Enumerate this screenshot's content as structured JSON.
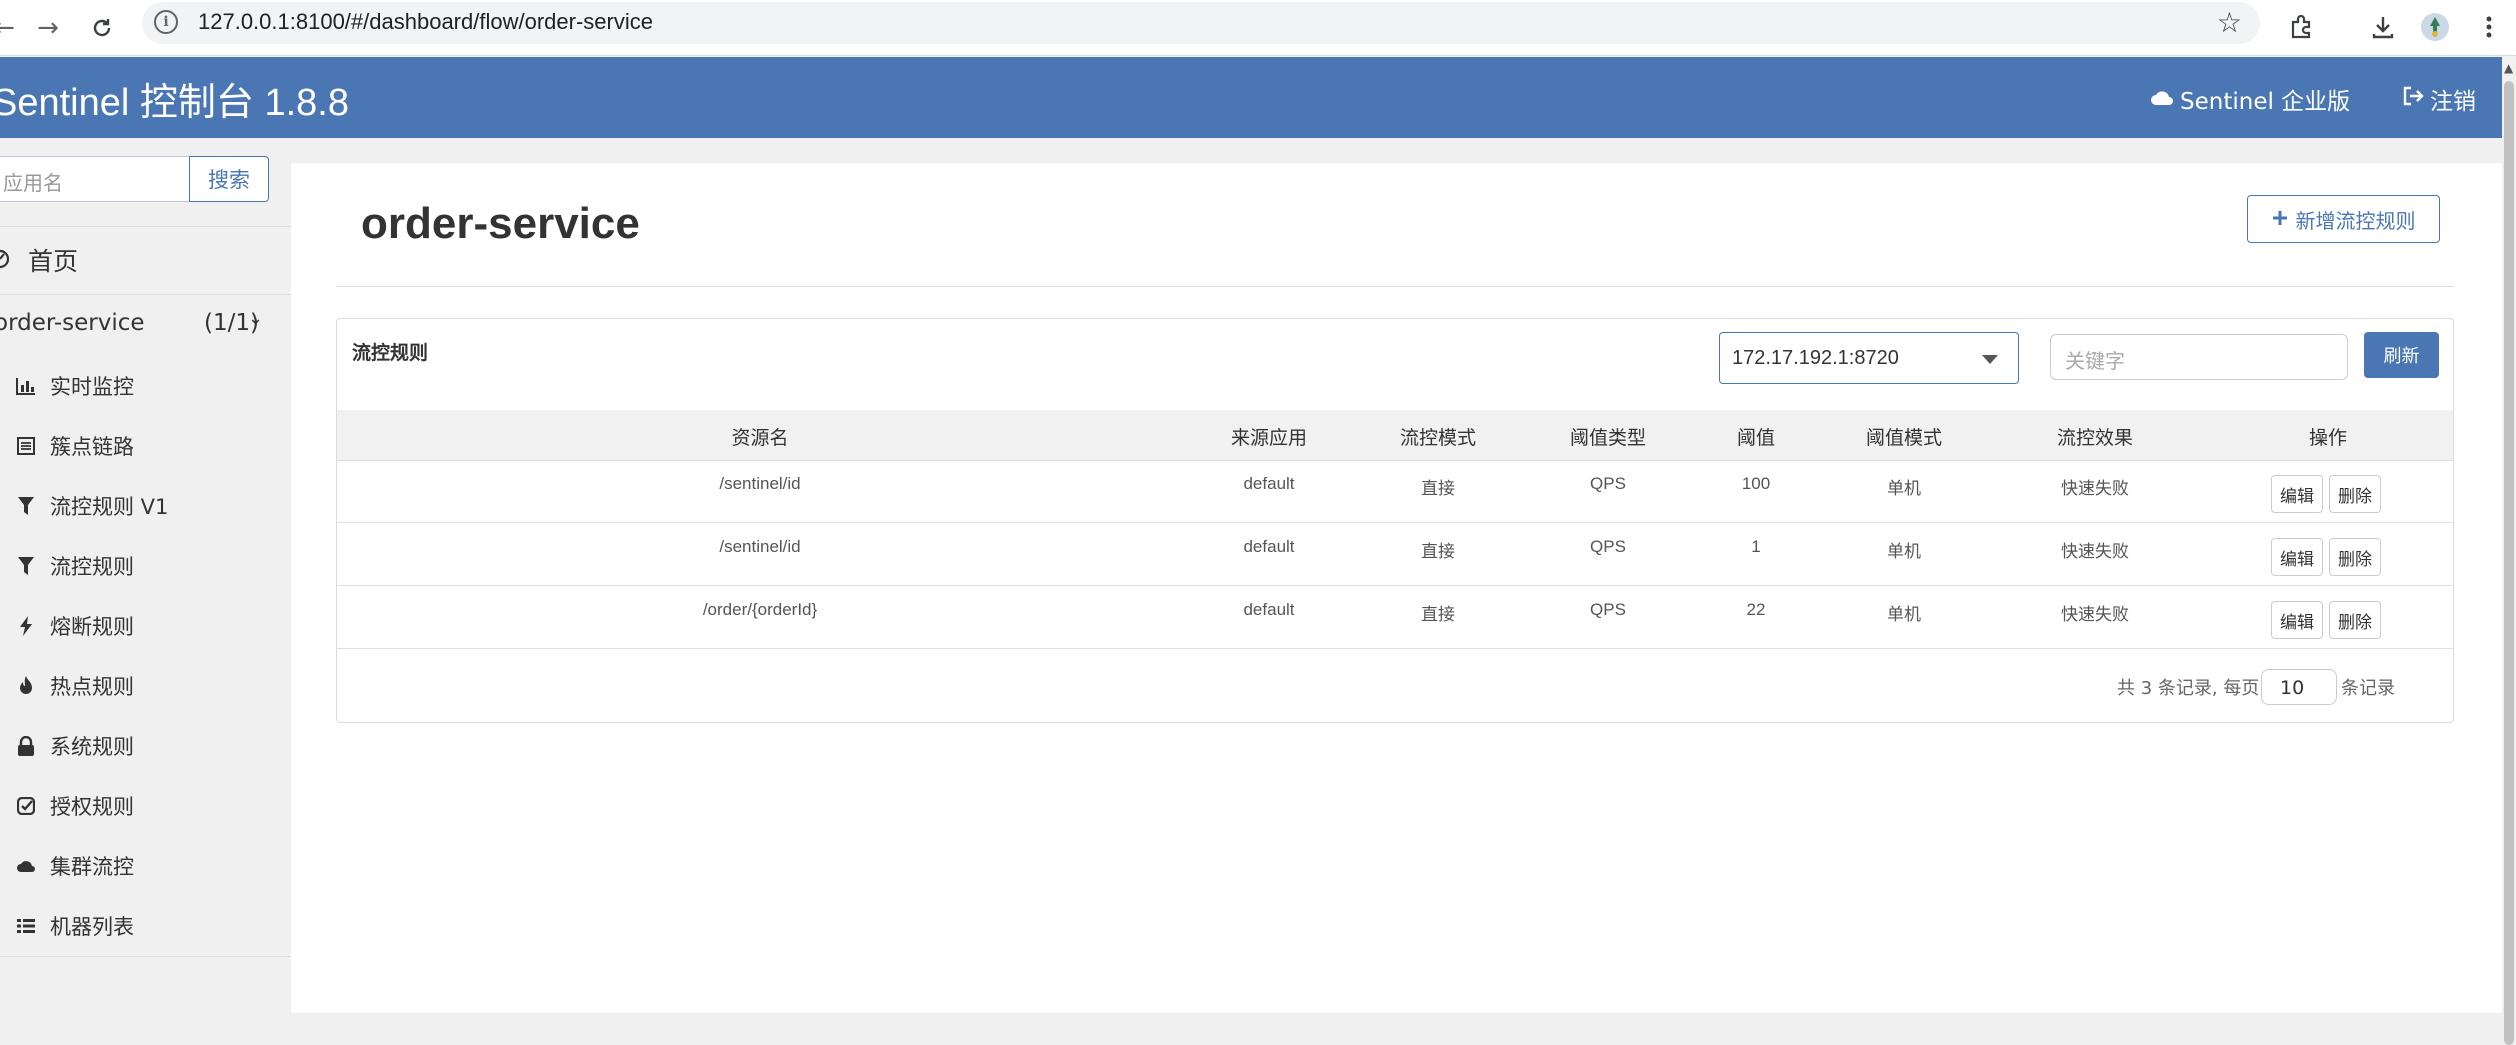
{
  "browser": {
    "url": "127.0.0.1:8100/#/dashboard/flow/order-service"
  },
  "header": {
    "brand": "Sentinel 控制台 1.8.8",
    "enterprise_label": "Sentinel 企业版",
    "logout_label": "注销"
  },
  "sidebar": {
    "search_placeholder": "应用名",
    "search_button": "搜索",
    "home_label": "首页",
    "app_name": "order-service",
    "app_count": "(1/1)",
    "menu": [
      {
        "label": "实时监控",
        "icon": "bar-chart-icon"
      },
      {
        "label": "簇点链路",
        "icon": "list-alt-icon"
      },
      {
        "label": "流控规则 V1",
        "icon": "filter-icon"
      },
      {
        "label": "流控规则",
        "icon": "filter-icon"
      },
      {
        "label": "熔断规则",
        "icon": "flash-icon"
      },
      {
        "label": "热点规则",
        "icon": "fire-icon"
      },
      {
        "label": "系统规则",
        "icon": "lock-icon"
      },
      {
        "label": "授权规则",
        "icon": "check-square-icon"
      },
      {
        "label": "集群流控",
        "icon": "cloud-icon"
      },
      {
        "label": "机器列表",
        "icon": "list-icon"
      }
    ]
  },
  "main": {
    "title": "order-service",
    "add_button": "新增流控规则",
    "card_title": "流控规则",
    "machine_select": "172.17.192.1:8720",
    "keyword_placeholder": "关键字",
    "refresh_button": "刷新",
    "columns": [
      "资源名",
      "来源应用",
      "流控模式",
      "阈值类型",
      "阈值",
      "阈值模式",
      "流控效果",
      "操作"
    ],
    "rows": [
      {
        "resource": "/sentinel/id",
        "origin": "default",
        "mode": "直接",
        "grade": "QPS",
        "count": "100",
        "cluster_mode": "单机",
        "effect": "快速失败"
      },
      {
        "resource": "/sentinel/id",
        "origin": "default",
        "mode": "直接",
        "grade": "QPS",
        "count": "1",
        "cluster_mode": "单机",
        "effect": "快速失败"
      },
      {
        "resource": "/order/{orderId}",
        "origin": "default",
        "mode": "直接",
        "grade": "QPS",
        "count": "22",
        "cluster_mode": "单机",
        "effect": "快速失败"
      }
    ],
    "edit_label": "编辑",
    "delete_label": "删除",
    "pager_prefix": "共 3 条记录, 每页",
    "page_size": "10",
    "pager_suffix": "条记录"
  },
  "colors": {
    "primary": "#4a77b4",
    "header_bg": "#4a77b4",
    "page_bg": "#f0f0f0"
  }
}
